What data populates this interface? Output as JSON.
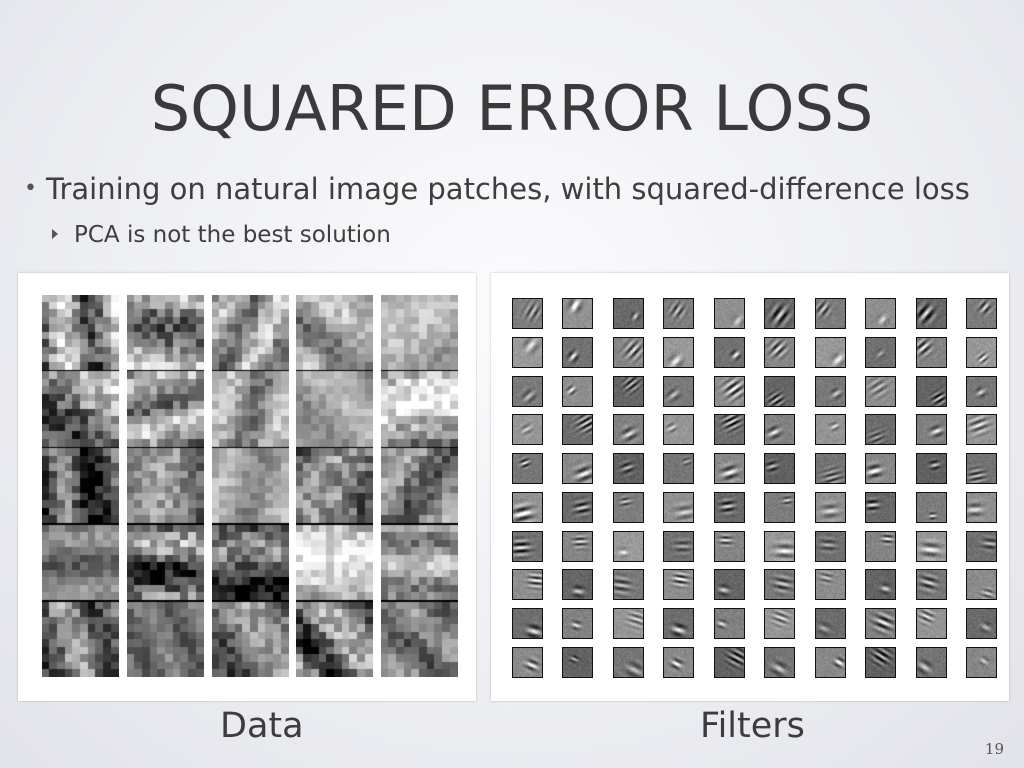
{
  "slide": {
    "title": "SQUARED ERROR LOSS",
    "bullets": [
      {
        "text": "Training on natural image patches, with squared-difference loss",
        "subbullets": [
          {
            "text": "PCA is not the best solution"
          }
        ]
      }
    ],
    "figures": {
      "data": {
        "caption": "Data",
        "columns": 5,
        "patches_per_column": 5
      },
      "filters": {
        "caption": "Filters",
        "columns": 10,
        "rows": 10
      }
    },
    "page_number": "19"
  }
}
